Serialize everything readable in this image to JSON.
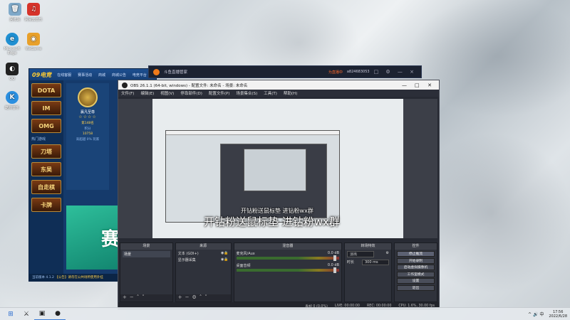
{
  "desktop": {
    "icons": [
      {
        "name": "recycle-bin-icon",
        "label": "回收站",
        "glyph": "🗑",
        "color": "#7fa9c9"
      },
      {
        "name": "netease-music-icon",
        "label": "网易云音乐",
        "glyph": "♫",
        "color": "#d6332a"
      },
      {
        "name": "edge-icon",
        "label": "Microsoft Edge",
        "glyph": "e",
        "color": "#1f8fd1"
      },
      {
        "name": "wegame-icon",
        "label": "WeGame",
        "glyph": "◉",
        "color": "#e8a02a"
      },
      {
        "name": "qq-icon",
        "label": "QQ",
        "glyph": "◐",
        "color": "#222222"
      },
      {
        "name": "kugou-icon",
        "label": "酷狗音乐",
        "glyph": "K",
        "color": "#2a8fe0"
      }
    ]
  },
  "launcher": {
    "logo": "09电竞",
    "nav": [
      "在线客服",
      "赛事活动",
      "商城",
      "商城公告",
      "电竞平台"
    ],
    "games": [
      "DOTA",
      "IM",
      "OMG",
      "刀塔",
      "东吴",
      "自走棋",
      "卡牌"
    ],
    "side_label": "热门游戏",
    "profile": {
      "name": "嬴凡至尊",
      "stars": "☆☆☆☆",
      "level": "第148名",
      "score_label": "积分",
      "score": "10758",
      "vip": "高超越 0% 玩家"
    },
    "banner_text": "赛",
    "footer_version": "当前版本 4.1.2",
    "footer_warning": "【公告】请勿在公共场所使用外挂"
  },
  "douyu": {
    "title": "斗鱼直播管家",
    "status": "为直播中",
    "uid": "a824683053",
    "tools": "□ ⚙ — ×"
  },
  "obs": {
    "title": "OBS 26.1.1 (64-bit, windows) - 配置文件: 未命名 - 场景: 未命名",
    "menu": [
      "文件(F)",
      "编辑(E)",
      "视图(V)",
      "停靠部件(D)",
      "配置文件(P)",
      "场景集合(S)",
      "工具(T)",
      "帮助(H)"
    ],
    "overlay_small": "开钻粉送鼠标垫 进钻粉wx群",
    "overlay_big": "开钻粉送鼠标垫  进钻粉wx群",
    "docks": {
      "scenes": {
        "title": "场景",
        "items": [
          "场景"
        ]
      },
      "sources": {
        "title": "来源",
        "items": [
          "文本 (GDI+)",
          "显示器采集"
        ]
      },
      "mixer": {
        "title": "混音器",
        "tracks": [
          {
            "name": "麦克风/Aux",
            "db": "0.0 dB"
          },
          {
            "name": "桌面音频",
            "db": "0.0 dB"
          }
        ]
      },
      "transitions": {
        "title": "转场特效",
        "type": "淡出",
        "duration_label": "时长",
        "duration": "300 ms"
      },
      "controls": {
        "title": "控件",
        "buttons": [
          "停止推流",
          "开始录制",
          "启动虚拟摄像机",
          "工作室模式",
          "设置",
          "退出"
        ]
      }
    },
    "status": {
      "drop": "丢帧 0 (0.0%)",
      "live": "LIVE: 00:00:00",
      "rec": "REC: 00:00:00",
      "cpu": "CPU: 1.6%, 30.00 fps"
    }
  },
  "taskbar": {
    "apps": [
      "⊞",
      "⚔",
      "▣",
      "●"
    ],
    "tray": "^ 🔊 中",
    "time": "17:56",
    "date": "2022/6/28"
  }
}
